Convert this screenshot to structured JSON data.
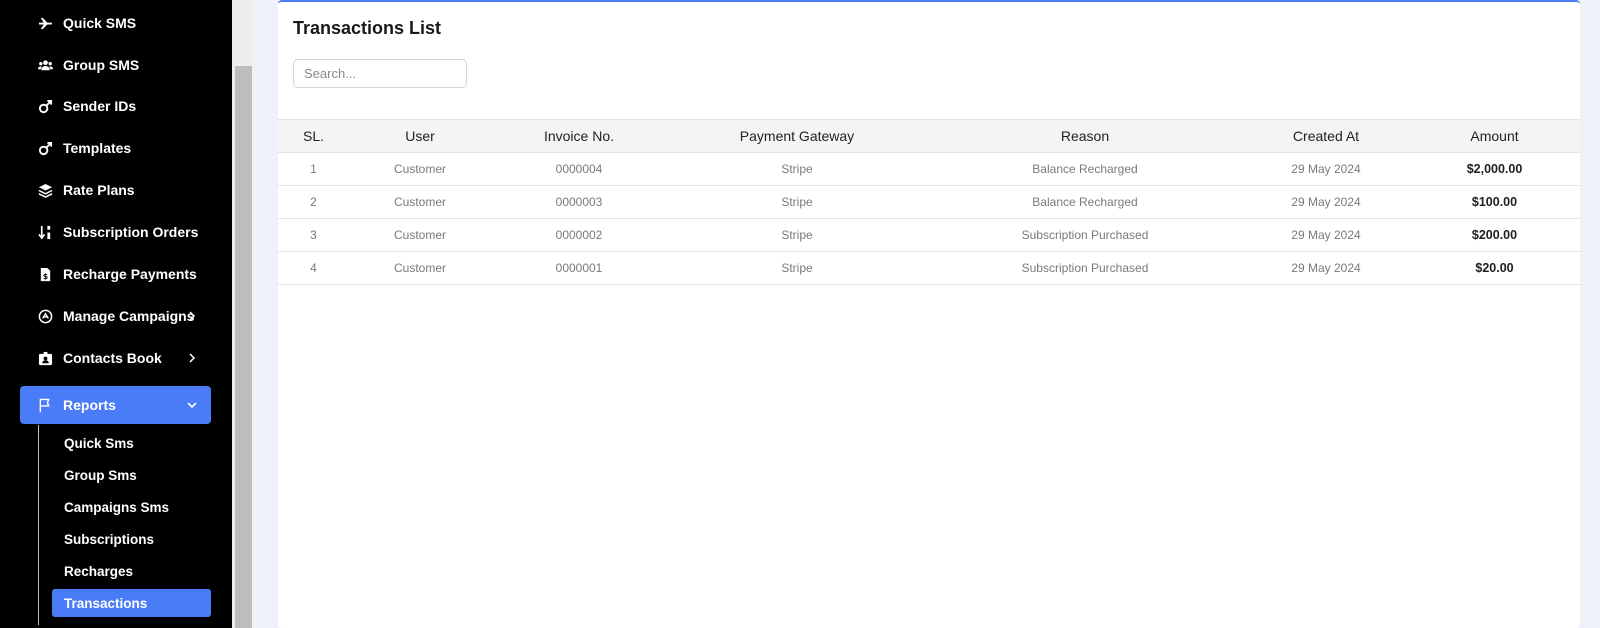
{
  "sidebar": {
    "items": [
      {
        "label": "Quick SMS",
        "icon": "plane-icon"
      },
      {
        "label": "Group SMS",
        "icon": "users-icon"
      },
      {
        "label": "Sender IDs",
        "icon": "mars-icon"
      },
      {
        "label": "Templates",
        "icon": "mars-icon"
      },
      {
        "label": "Rate Plans",
        "icon": "layers-icon"
      },
      {
        "label": "Subscription Orders",
        "icon": "sort-icon"
      },
      {
        "label": "Recharge Payments",
        "icon": "invoice-dollar-icon"
      },
      {
        "label": "Manage Campaigns",
        "icon": "campaign-icon"
      },
      {
        "label": "Contacts Book",
        "icon": "contact-card-icon"
      },
      {
        "label": "Reports",
        "icon": "flag-icon"
      }
    ],
    "report_sub_items": [
      {
        "label": "Quick Sms"
      },
      {
        "label": "Group Sms"
      },
      {
        "label": "Campaigns Sms"
      },
      {
        "label": "Subscriptions"
      },
      {
        "label": "Recharges"
      },
      {
        "label": "Transactions"
      }
    ],
    "active_color": "#4a7cf7"
  },
  "main": {
    "title": "Transactions List",
    "search": {
      "placeholder": "Search...",
      "value": ""
    },
    "table": {
      "columns": [
        "SL.",
        "User",
        "Invoice No.",
        "Payment Gateway",
        "Reason",
        "Created At",
        "Amount"
      ],
      "rows": [
        {
          "sl": "1",
          "user": "Customer",
          "invoice": "0000004",
          "gateway": "Stripe",
          "reason": "Balance Recharged",
          "created": "29 May 2024",
          "amount": "$2,000.00"
        },
        {
          "sl": "2",
          "user": "Customer",
          "invoice": "0000003",
          "gateway": "Stripe",
          "reason": "Balance Recharged",
          "created": "29 May 2024",
          "amount": "$100.00"
        },
        {
          "sl": "3",
          "user": "Customer",
          "invoice": "0000002",
          "gateway": "Stripe",
          "reason": "Subscription Purchased",
          "created": "29 May 2024",
          "amount": "$200.00"
        },
        {
          "sl": "4",
          "user": "Customer",
          "invoice": "0000001",
          "gateway": "Stripe",
          "reason": "Subscription Purchased",
          "created": "29 May 2024",
          "amount": "$20.00"
        }
      ]
    }
  }
}
